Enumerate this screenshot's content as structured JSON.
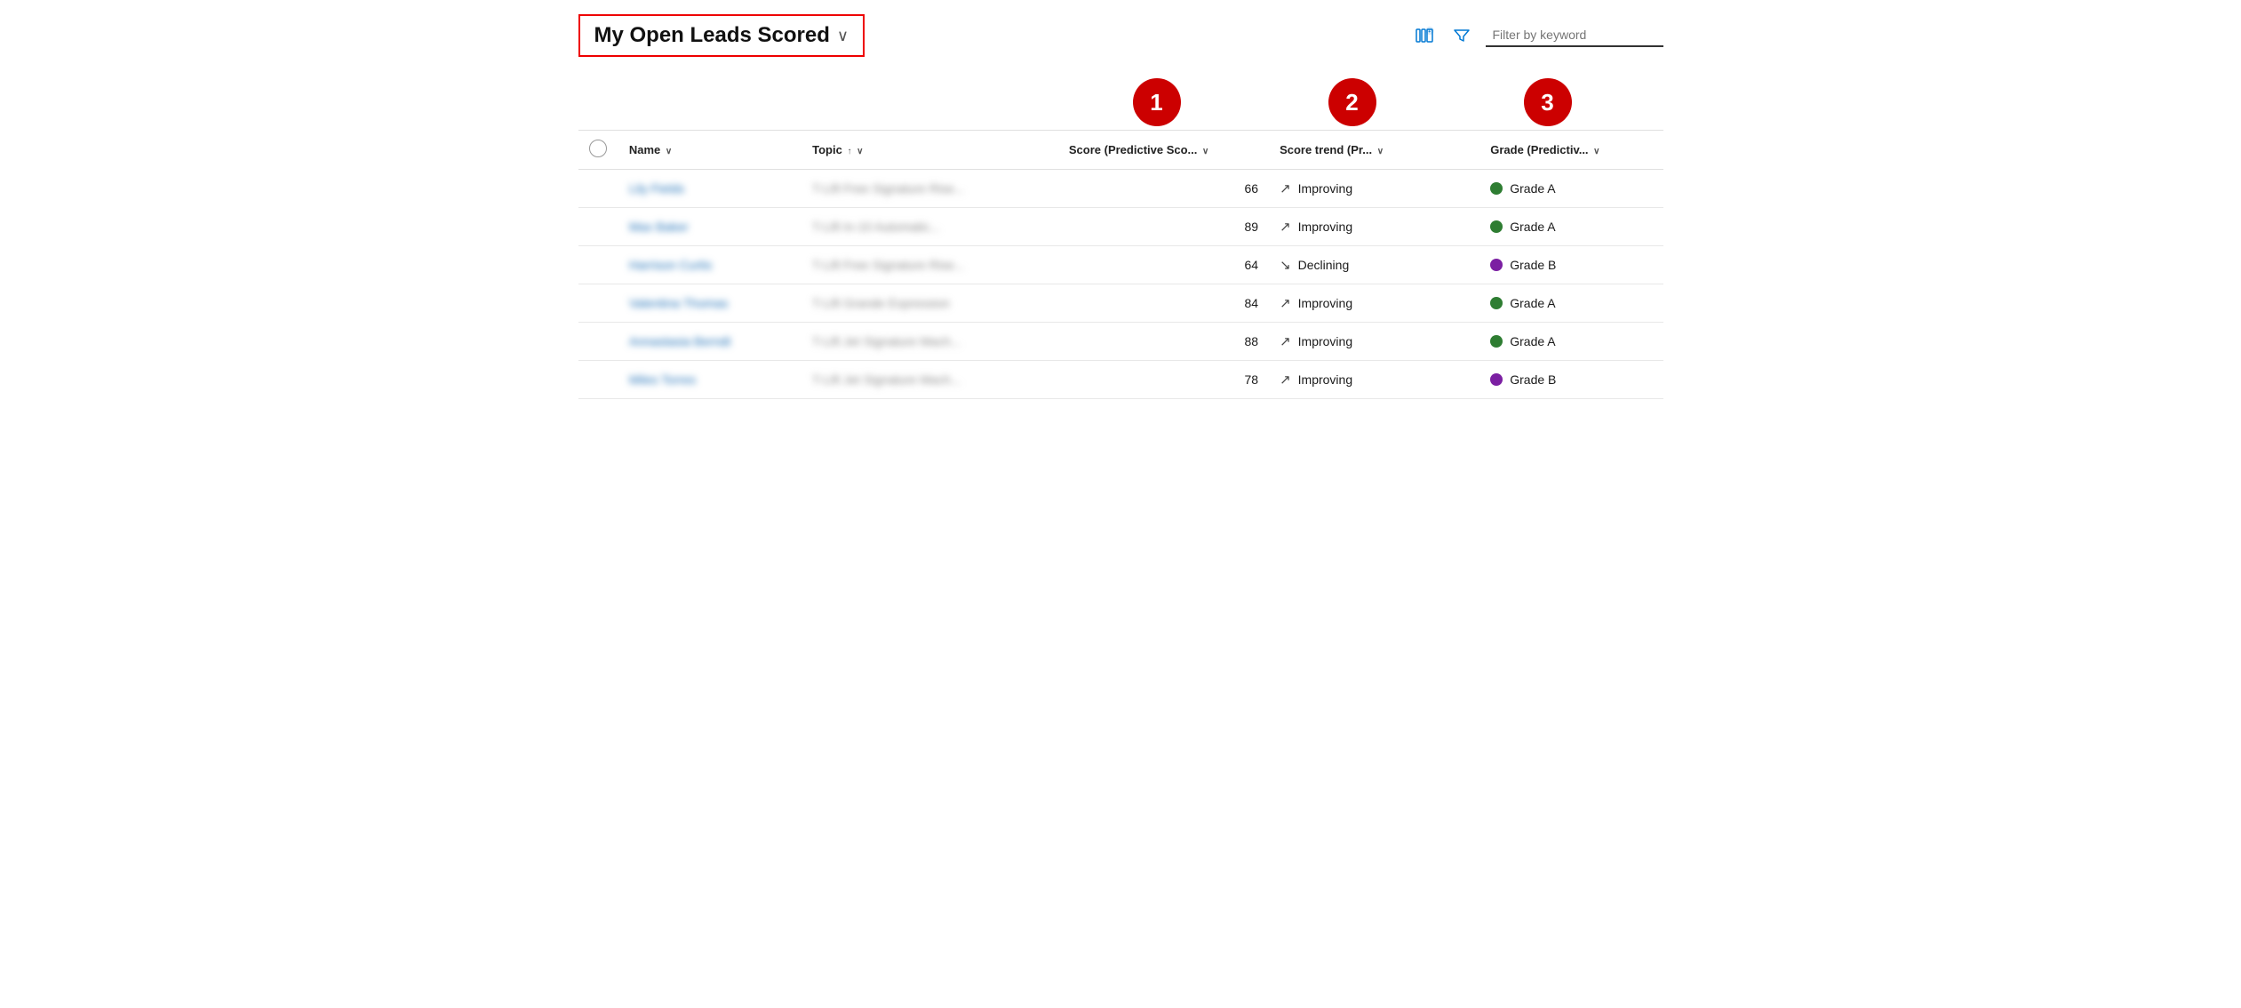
{
  "header": {
    "title": "My Open Leads Scored",
    "chevron": "∨",
    "filter_placeholder": "Filter by keyword"
  },
  "annotations": [
    {
      "label": "1"
    },
    {
      "label": "2"
    },
    {
      "label": "3"
    }
  ],
  "columns": [
    {
      "key": "check",
      "label": ""
    },
    {
      "key": "name",
      "label": "Name",
      "sort": "∨"
    },
    {
      "key": "topic",
      "label": "Topic",
      "sort": "↑ ∨"
    },
    {
      "key": "score",
      "label": "Score (Predictive Sco...",
      "sort": "∨"
    },
    {
      "key": "trend",
      "label": "Score trend (Pr...",
      "sort": "∨"
    },
    {
      "key": "grade",
      "label": "Grade (Predictiv...",
      "sort": "∨"
    }
  ],
  "rows": [
    {
      "name": "Lily Fields",
      "topic": "T-Lift Free Signature Rise...",
      "score": "66",
      "trend_arrow": "↗",
      "trend_label": "Improving",
      "grade_color": "green",
      "grade_label": "Grade A"
    },
    {
      "name": "Max Baker",
      "topic": "T-Lift In-10 Automatic...",
      "score": "89",
      "trend_arrow": "↗",
      "trend_label": "Improving",
      "grade_color": "green",
      "grade_label": "Grade A"
    },
    {
      "name": "Harrison Curtis",
      "topic": "T-Lift Free Signature Rise...",
      "score": "64",
      "trend_arrow": "↘",
      "trend_label": "Declining",
      "grade_color": "purple",
      "grade_label": "Grade B"
    },
    {
      "name": "Valentina Thomas",
      "topic": "T-Lift Grande Expression",
      "score": "84",
      "trend_arrow": "↗",
      "trend_label": "Improving",
      "grade_color": "green",
      "grade_label": "Grade A"
    },
    {
      "name": "Annastasia Berndt",
      "topic": "T-Lift Jet Signature Mach...",
      "score": "88",
      "trend_arrow": "↗",
      "trend_label": "Improving",
      "grade_color": "green",
      "grade_label": "Grade A"
    },
    {
      "name": "Miles Torres",
      "topic": "T-Lift Jet Signature Mach...",
      "score": "78",
      "trend_arrow": "↗",
      "trend_label": "Improving",
      "grade_color": "purple",
      "grade_label": "Grade B"
    }
  ],
  "icons": {
    "columns_icon": "⊞",
    "filter_icon": "⛊"
  }
}
